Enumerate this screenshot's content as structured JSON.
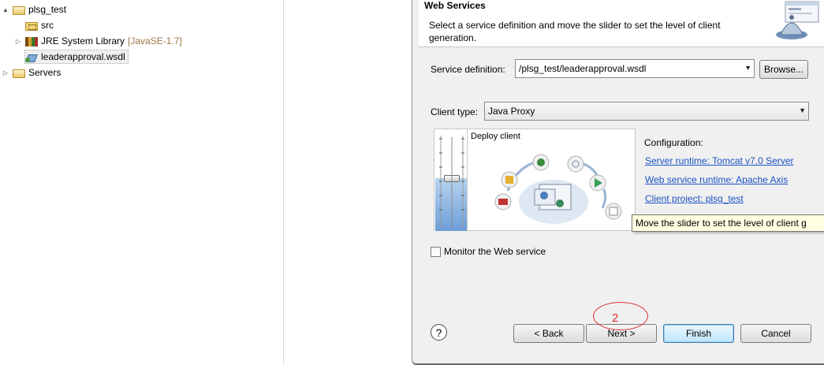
{
  "explorer": {
    "items": [
      {
        "label": "plsg_test",
        "twisty": "▲",
        "icon": "folder-open-icon"
      },
      {
        "label": "src",
        "icon": "package-folder-icon"
      },
      {
        "label": "JRE System Library",
        "version": "[JavaSE-1.7]",
        "twisty": "▷",
        "icon": "library-icon"
      },
      {
        "label": "leaderapproval.wsdl",
        "icon": "wsdl-file-icon",
        "selected": true
      },
      {
        "label": "Servers",
        "twisty": "▷",
        "icon": "folder-icon"
      }
    ]
  },
  "dialog": {
    "title": "Web Services",
    "description": "Select a service definition and move the slider to set the level of client generation.",
    "service_definition_label": "Service definition:",
    "service_definition_value": "/plsg_test/leaderapproval.wsdl",
    "browse_label": "Browse...",
    "client_type_label": "Client type:",
    "client_type_value": "Java Proxy",
    "slider_stage_label": "Deploy client",
    "slider_level": 0.55,
    "configuration_label": "Configuration:",
    "server_runtime_link": "Server runtime: Tomcat v7.0 Server",
    "web_service_runtime_link": "Web service runtime: Apache Axis",
    "client_project_link": "Client project: plsg_test",
    "tooltip": "Move the slider to set the level of client g",
    "monitor_label": "Monitor the Web service",
    "monitor_checked": false,
    "buttons": {
      "back": "< Back",
      "next": "Next >",
      "finish": "Finish",
      "cancel": "Cancel"
    },
    "annotation": "2"
  },
  "colors": {
    "link": "#1a52c4",
    "annotation": "#e03030",
    "slider_fill": "#6d9ed8"
  }
}
